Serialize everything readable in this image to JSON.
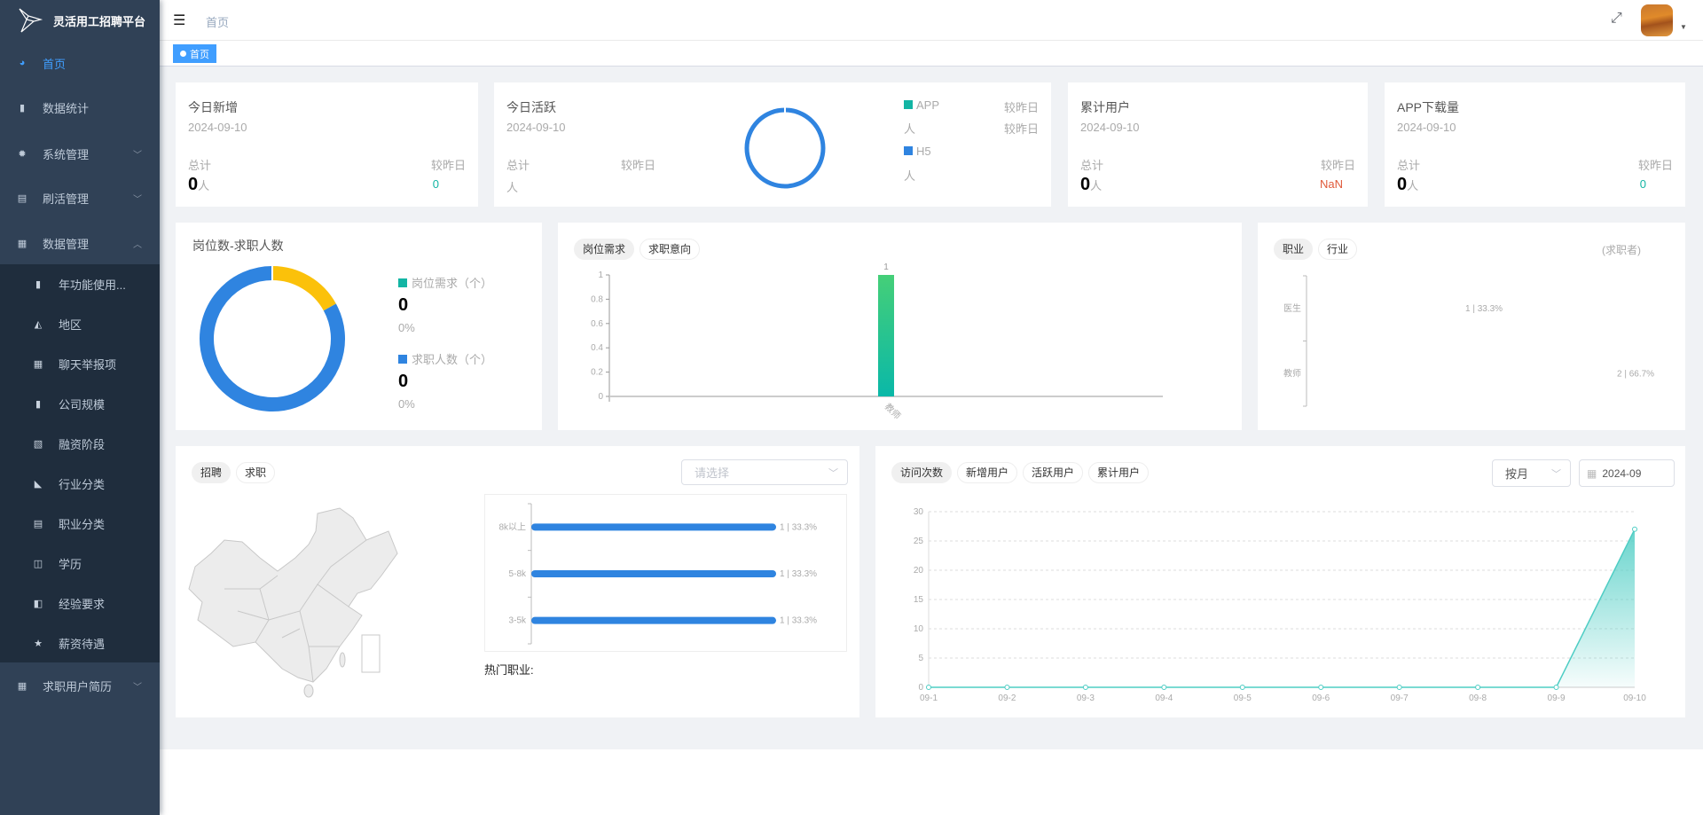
{
  "app": {
    "title": "灵活用工招聘平台"
  },
  "sidebar": {
    "items": [
      {
        "label": "首页",
        "icon": "dashboard-icon",
        "active": true
      },
      {
        "label": "数据统计",
        "icon": "bar-chart-icon"
      },
      {
        "label": "系统管理",
        "icon": "gear-icon"
      },
      {
        "label": "刷活管理",
        "icon": "document-icon"
      },
      {
        "label": "数据管理",
        "icon": "table-icon",
        "expanded": true
      },
      {
        "label": "求职用户简历",
        "icon": "table-icon"
      }
    ],
    "sub_items": [
      {
        "label": "年功能使用...",
        "icon": "bar-chart-icon"
      },
      {
        "label": "地区",
        "icon": "area-chart-icon"
      },
      {
        "label": "聊天举报项",
        "icon": "table-icon"
      },
      {
        "label": "公司规模",
        "icon": "bar-chart-icon"
      },
      {
        "label": "融资阶段",
        "icon": "pulse-icon"
      },
      {
        "label": "行业分类",
        "icon": "factory-icon"
      },
      {
        "label": "职业分类",
        "icon": "file-icon"
      },
      {
        "label": "学历",
        "icon": "book-icon"
      },
      {
        "label": "经验要求",
        "icon": "door-icon"
      },
      {
        "label": "薪资待遇",
        "icon": "star-icon"
      }
    ]
  },
  "header": {
    "breadcrumb": "首页"
  },
  "tags": {
    "active": "首页",
    "active_color": "#409eff"
  },
  "stats": {
    "new_today": {
      "title": "今日新增",
      "date": "2024-09-10",
      "total_label": "总计",
      "total": "0",
      "unit": "人",
      "compare_label": "较昨日",
      "compare": "0"
    },
    "active_today": {
      "title": "今日活跃",
      "date": "2024-09-10",
      "total_label": "总计",
      "unit": "人",
      "compare_label": "较昨日",
      "legend": [
        {
          "name": "APP",
          "color": "#13b5a4",
          "unit": "人",
          "compare_label": "较昨日"
        },
        {
          "name": "H5",
          "color": "#2f84e0",
          "unit": "人",
          "compare_label": "较昨日"
        }
      ]
    },
    "total_users": {
      "title": "累计用户",
      "date": "2024-09-10",
      "total_label": "总计",
      "total": "0",
      "unit": "人",
      "compare_label": "较昨日",
      "compare": "NaN",
      "compare_color": "#e05a3a"
    },
    "app_downloads": {
      "title": "APP下载量",
      "date": "2024-09-10",
      "total_label": "总计",
      "total": "0",
      "unit": "人",
      "compare_label": "较昨日",
      "compare": "0"
    }
  },
  "chart_data": [
    {
      "type": "pie",
      "title": "岗位数-求职人数",
      "donut": true,
      "legend": [
        {
          "name": "岗位需求（个）",
          "value": "0",
          "percent": "0%",
          "color": "#13b5a4"
        },
        {
          "name": "求职人数（个）",
          "value": "0",
          "percent": "0%",
          "color": "#2f84e0"
        }
      ],
      "slices": [
        {
          "color": "#fbc10a",
          "fraction": 0.17
        },
        {
          "color": "#2f84e0",
          "fraction": 0.83
        }
      ]
    },
    {
      "type": "bar",
      "tabs": [
        "岗位需求",
        "求职意向"
      ],
      "active_tab": 0,
      "categories": [
        "教师"
      ],
      "values": [
        1
      ],
      "data_labels": [
        "1"
      ],
      "ylim": [
        0,
        1
      ],
      "yticks": [
        "0",
        "0.2",
        "0.4",
        "0.6",
        "0.8",
        "1"
      ]
    },
    {
      "type": "bar",
      "orientation": "horizontal",
      "tabs": [
        "职业",
        "行业"
      ],
      "active_tab": 0,
      "note": "(求职者)",
      "categories": [
        "医生",
        "教师"
      ],
      "values": [
        1,
        2
      ],
      "data_labels": [
        "1 | 33.3%",
        "2 | 66.7%"
      ]
    },
    {
      "type": "bar",
      "orientation": "horizontal",
      "tabs": [
        "招聘",
        "求职"
      ],
      "active_tab": 0,
      "select_placeholder": "请选择",
      "categories": [
        "8k以上",
        "5-8k",
        "3-5k"
      ],
      "values": [
        1,
        1,
        1
      ],
      "data_labels": [
        "1 | 33.3%",
        "1 | 33.3%",
        "1 | 33.3%"
      ],
      "footer": "热门职业:"
    },
    {
      "type": "area",
      "tabs": [
        "访问次数",
        "新增用户",
        "活跃用户",
        "累计用户"
      ],
      "active_tab": 0,
      "period": "按月",
      "month": "2024-09",
      "x": [
        "09-1",
        "09-2",
        "09-3",
        "09-4",
        "09-5",
        "09-6",
        "09-7",
        "09-8",
        "09-9",
        "09-10"
      ],
      "values": [
        0,
        0,
        0,
        0,
        0,
        0,
        0,
        0,
        0,
        27
      ],
      "ylim": [
        0,
        30
      ],
      "yticks": [
        "0",
        "5",
        "10",
        "15",
        "20",
        "25",
        "30"
      ],
      "grid": true,
      "color": "#4ecdc4"
    }
  ]
}
